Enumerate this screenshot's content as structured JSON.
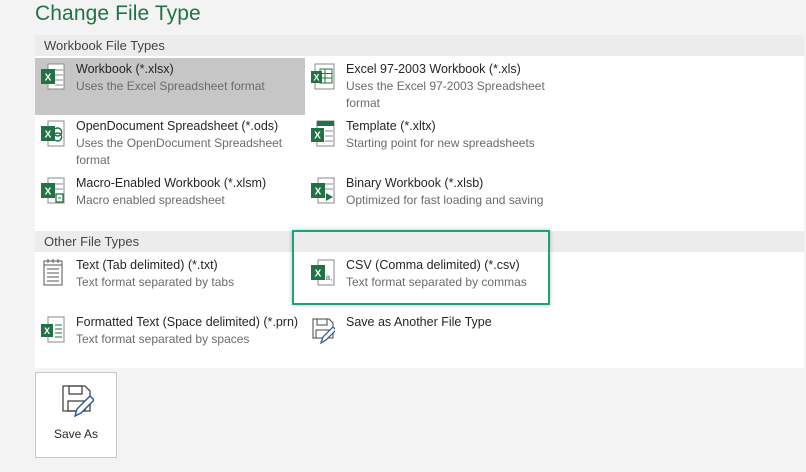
{
  "page": {
    "title": "Change File Type"
  },
  "sections": {
    "workbook": {
      "header": "Workbook File Types"
    },
    "other": {
      "header": "Other File Types"
    }
  },
  "items": {
    "xlsx": {
      "title": "Workbook (*.xlsx)",
      "desc": "Uses the Excel Spreadsheet format",
      "icon": "excel-workbook-icon"
    },
    "xls": {
      "title": "Excel 97-2003 Workbook (*.xls)",
      "desc": "Uses the Excel 97-2003 Spreadsheet format",
      "icon": "excel-97-2003-icon"
    },
    "ods": {
      "title": "OpenDocument Spreadsheet (*.ods)",
      "desc": "Uses the OpenDocument Spreadsheet format",
      "icon": "opendocument-icon"
    },
    "xltx": {
      "title": "Template (*.xltx)",
      "desc": "Starting point for new spreadsheets",
      "icon": "template-icon"
    },
    "xlsm": {
      "title": "Macro-Enabled Workbook (*.xlsm)",
      "desc": "Macro enabled spreadsheet",
      "icon": "macro-workbook-icon"
    },
    "xlsb": {
      "title": "Binary Workbook (*.xlsb)",
      "desc": "Optimized for fast loading and saving",
      "icon": "binary-workbook-icon"
    },
    "txt": {
      "title": "Text (Tab delimited) (*.txt)",
      "desc": "Text format separated by tabs",
      "icon": "text-file-icon"
    },
    "csv": {
      "title": "CSV (Comma delimited) (*.csv)",
      "desc": "Text format separated by commas",
      "icon": "csv-file-icon"
    },
    "prn": {
      "title": "Formatted Text (Space delimited) (*.prn)",
      "desc": "Text format separated by spaces",
      "icon": "formatted-text-icon"
    },
    "another": {
      "title": "Save as Another File Type",
      "desc": "",
      "icon": "save-as-another-icon"
    }
  },
  "selected_item": "xlsx",
  "highlighted_item": "csv",
  "save_as": {
    "label": "Save As",
    "icon": "save-as-icon"
  },
  "colors": {
    "accent": "#217346",
    "highlight": "#1aa37e",
    "selected": "#c6c6c6"
  }
}
